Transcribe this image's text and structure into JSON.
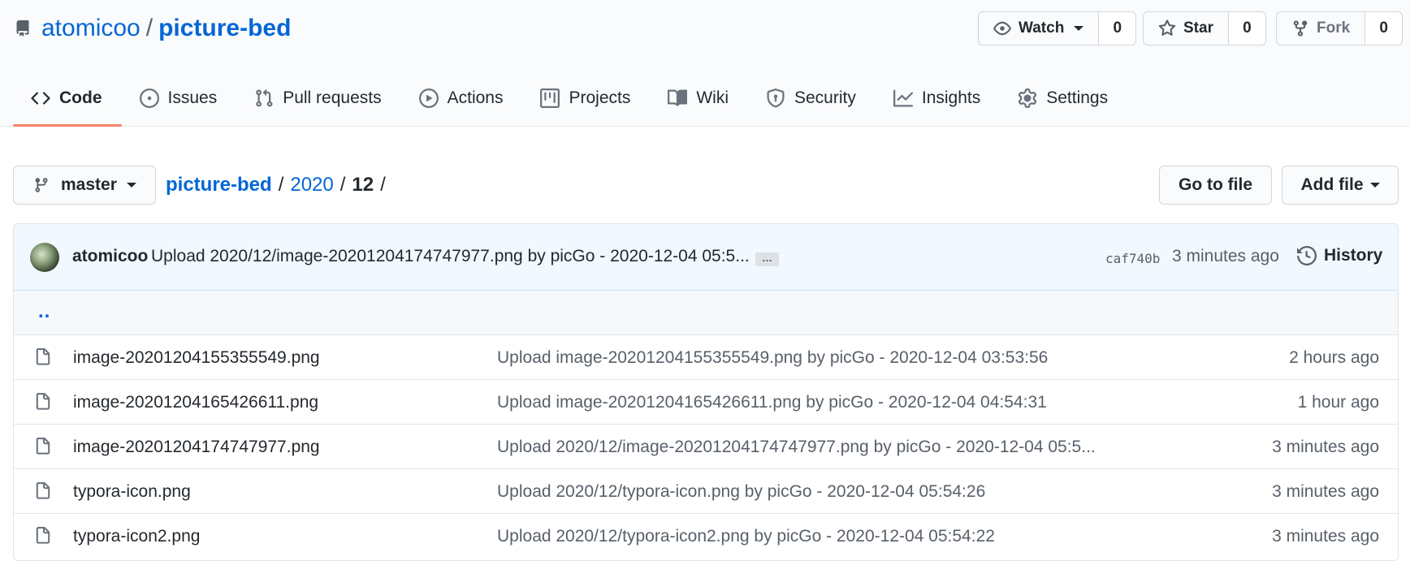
{
  "repo": {
    "owner": "atomicoo",
    "separator": "/",
    "name": "picture-bed"
  },
  "actions": {
    "watch": {
      "label": "Watch",
      "count": "0"
    },
    "star": {
      "label": "Star",
      "count": "0"
    },
    "fork": {
      "label": "Fork",
      "count": "0"
    }
  },
  "tabs": [
    {
      "label": "Code",
      "icon": "code-icon",
      "active": true
    },
    {
      "label": "Issues",
      "icon": "issue-icon"
    },
    {
      "label": "Pull requests",
      "icon": "pull-request-icon"
    },
    {
      "label": "Actions",
      "icon": "play-icon"
    },
    {
      "label": "Projects",
      "icon": "project-icon"
    },
    {
      "label": "Wiki",
      "icon": "book-icon"
    },
    {
      "label": "Security",
      "icon": "shield-icon"
    },
    {
      "label": "Insights",
      "icon": "graph-icon"
    },
    {
      "label": "Settings",
      "icon": "gear-icon"
    }
  ],
  "branch": {
    "name": "master"
  },
  "breadcrumb": {
    "root": "picture-bed",
    "sep": "/",
    "year": "2020",
    "current": "12"
  },
  "buttons": {
    "go_to_file": "Go to file",
    "add_file": "Add file"
  },
  "commit": {
    "author": "atomicoo",
    "message": "Upload 2020/12/image-20201204174747977.png by picGo - 2020-12-04 05:5...",
    "ellipsis": "…",
    "sha": "caf740b",
    "time": "3 minutes ago",
    "history_label": "History"
  },
  "parent_dir": "..",
  "files": [
    {
      "name": "image-20201204155355549.png",
      "message": "Upload image-20201204155355549.png by picGo - 2020-12-04 03:53:56",
      "age": "2 hours ago"
    },
    {
      "name": "image-20201204165426611.png",
      "message": "Upload image-20201204165426611.png by picGo - 2020-12-04 04:54:31",
      "age": "1 hour ago"
    },
    {
      "name": "image-20201204174747977.png",
      "message": "Upload 2020/12/image-20201204174747977.png by picGo - 2020-12-04 05:5...",
      "age": "3 minutes ago"
    },
    {
      "name": "typora-icon.png",
      "message": "Upload 2020/12/typora-icon.png by picGo - 2020-12-04 05:54:26",
      "age": "3 minutes ago"
    },
    {
      "name": "typora-icon2.png",
      "message": "Upload 2020/12/typora-icon2.png by picGo - 2020-12-04 05:54:22",
      "age": "3 minutes ago"
    }
  ],
  "colors": {
    "link": "#0366d6",
    "active_tab_underline": "#f9826c",
    "commit_bar_bg": "#f1f8ff",
    "text": "#24292e",
    "muted": "#586069"
  }
}
